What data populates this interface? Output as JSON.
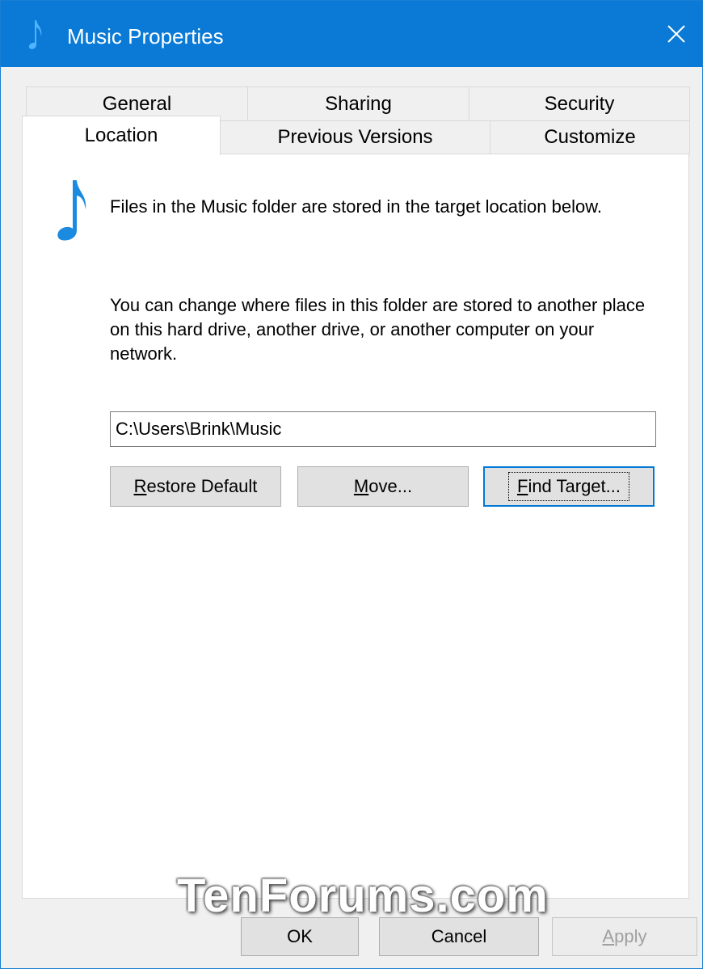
{
  "window": {
    "title": "Music Properties",
    "close_glyph": "✕",
    "accent_color": "#0a7ad6"
  },
  "tabs": {
    "row1": [
      "General",
      "Sharing",
      "Security"
    ],
    "row2": [
      "Location",
      "Previous Versions",
      "Customize"
    ],
    "active": "Location"
  },
  "location": {
    "icon": "music-note-icon",
    "text1": "Files in the Music folder are stored in the target location below.",
    "text2": "You can change where files in this folder are stored to another place on this hard drive, another drive, or another computer on your network.",
    "path_value": "C:\\Users\\Brink\\Music",
    "buttons": {
      "restore_accel": "R",
      "restore_rest": "estore Default",
      "move_accel": "M",
      "move_rest": "ove...",
      "find_accel": "F",
      "find_rest": "ind Target..."
    }
  },
  "footer": {
    "ok": "OK",
    "cancel": "Cancel",
    "apply_accel": "A",
    "apply_rest": "pply"
  },
  "watermark": "TenForums.com"
}
